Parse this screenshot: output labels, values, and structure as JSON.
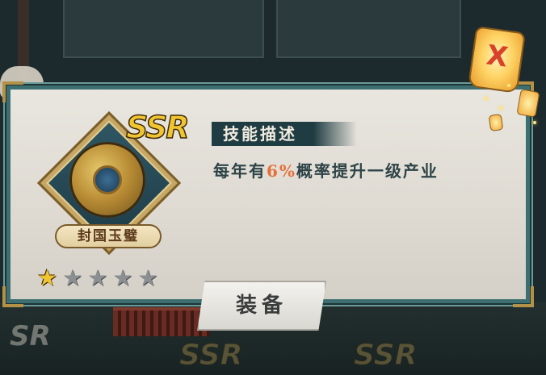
{
  "background": {
    "ssr_watermarks": [
      "SSR",
      "SSR"
    ],
    "sr_watermark": "SR"
  },
  "item": {
    "name": "封国玉璧",
    "rarity": "SSR",
    "icon": "jade-disc-icon",
    "stars": {
      "filled": 1,
      "total": 5
    }
  },
  "skill": {
    "title": "技能描述",
    "description_prefix": "每年有",
    "description_highlight": "6%",
    "description_suffix": "概率提升一级产业"
  },
  "buttons": {
    "equip_label": "装备",
    "close_icon": "close-x-icon",
    "close_symbol": "X"
  },
  "colors": {
    "panel_border": "#3d6f71",
    "gold": "#f1c431",
    "highlight": "#e56f3a",
    "skill_title_bar": "#1f3c42"
  }
}
